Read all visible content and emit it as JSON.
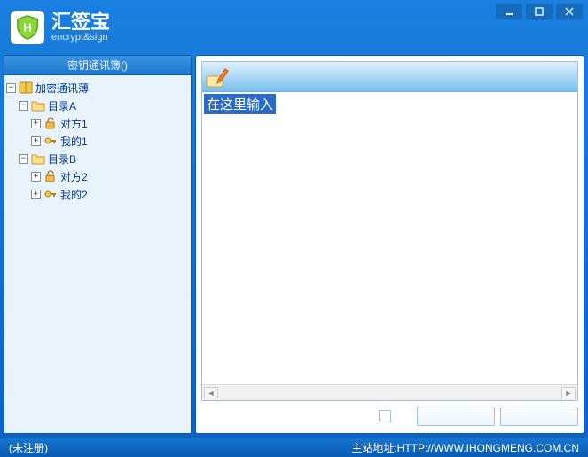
{
  "app": {
    "title": "汇签宝",
    "subtitle": "encrypt&sign"
  },
  "sidebar": {
    "header": "密钥通讯簿()",
    "tree": {
      "root": {
        "label": "加密通讯薄",
        "expanded": true
      },
      "dirA": {
        "label": "目录A",
        "expanded": true
      },
      "dirA_peer": {
        "label": "对方1"
      },
      "dirA_mine": {
        "label": "我的1"
      },
      "dirB": {
        "label": "目录B",
        "expanded": true
      },
      "dirB_peer": {
        "label": "对方2"
      },
      "dirB_mine": {
        "label": "我的2"
      }
    }
  },
  "editor": {
    "placeholder": "在这里输入"
  },
  "status": {
    "left": "(未注册)",
    "right": "主站地址:HTTP://WWW.IHONGMENG.COM.CN"
  }
}
